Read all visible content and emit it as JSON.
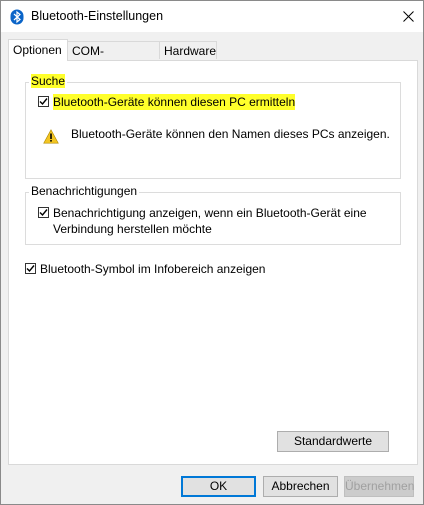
{
  "window": {
    "title": "Bluetooth-Einstellungen"
  },
  "tabs": [
    {
      "label": "Optionen",
      "active": true
    },
    {
      "label": "COM-Anschlüsse",
      "active": false
    },
    {
      "label": "Hardware",
      "active": false
    }
  ],
  "suche": {
    "legend": "Suche",
    "discoverable_label": "Bluetooth-Geräte können diesen PC ermitteln",
    "discoverable_checked": true,
    "warning_text": "Bluetooth-Geräte können den Namen dieses PCs anzeigen."
  },
  "notifications": {
    "legend": "Benachrichtigungen",
    "notify_label_line1": "Benachrichtigung anzeigen, wenn ein Bluetooth-Gerät eine",
    "notify_label_line2": "Verbindung herstellen möchte",
    "notify_checked": true
  },
  "tray": {
    "label": "Bluetooth-Symbol im Infobereich anzeigen",
    "checked": true
  },
  "buttons": {
    "defaults": "Standardwerte",
    "ok": "OK",
    "cancel": "Abbrechen",
    "apply": "Übernehmen"
  },
  "colors": {
    "highlight": "#ffff2b",
    "default_button_border": "#0078d7",
    "bluetooth_icon": "#0a64c8"
  },
  "icons": {
    "title": "bluetooth-icon",
    "close": "close-icon",
    "warning": "warning-icon",
    "check": "checkmark-icon"
  }
}
